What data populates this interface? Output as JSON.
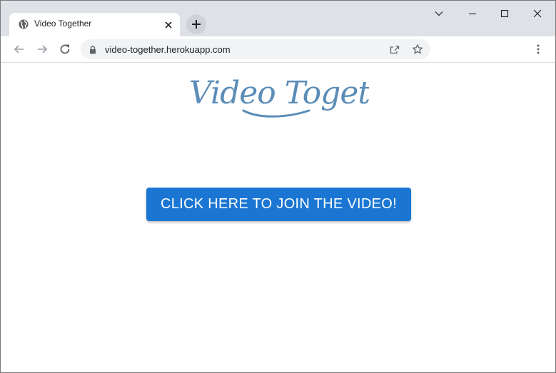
{
  "browser": {
    "tab": {
      "title": "Video Together",
      "favicon": "globe-icon",
      "close_icon": "close-icon"
    },
    "new_tab_icon": "plus-icon",
    "window_controls": [
      "chevron-down-icon",
      "minimize-icon",
      "maximize-icon",
      "close-icon"
    ],
    "toolbar": {
      "back_icon": "back-arrow-icon",
      "forward_icon": "forward-arrow-icon",
      "reload_icon": "reload-icon",
      "url": "video-together.herokuapp.com",
      "lock_icon": "lock-icon",
      "share_icon": "share-icon",
      "bookmark_icon": "star-icon",
      "menu_icon": "kebab-menu-icon"
    }
  },
  "page": {
    "logo_text": "Video Together",
    "logo_color": "#5b8db7",
    "join_button_label": "CLICK HERE TO JOIN THE VIDEO!",
    "accent_color": "#1a76d2"
  }
}
